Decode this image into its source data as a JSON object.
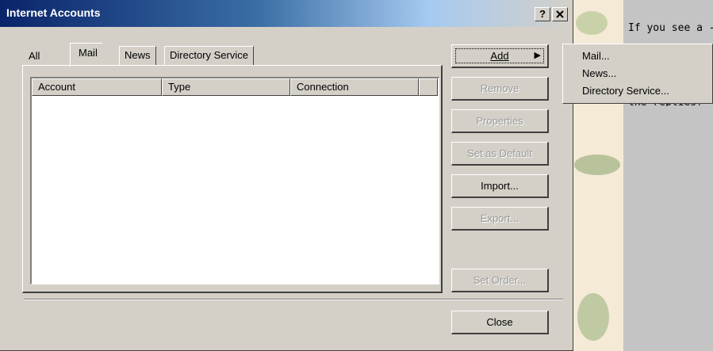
{
  "dialog": {
    "title": "Internet Accounts",
    "help_label": "?",
    "close_icon": "close-icon"
  },
  "tabs": [
    {
      "label": "All",
      "selected": false
    },
    {
      "label": "Mail",
      "selected": true
    },
    {
      "label": "News",
      "selected": false
    },
    {
      "label": "Directory Service",
      "selected": false
    }
  ],
  "list": {
    "columns": [
      "Account",
      "Type",
      "Connection"
    ],
    "rows": []
  },
  "buttons": {
    "add": "Add",
    "remove": "Remove",
    "properties": "Properties",
    "set_default": "Set as Default",
    "import": "Import...",
    "export": "Export...",
    "set_order": "Set Order...",
    "close": "Close"
  },
  "add_menu": {
    "items": [
      "Mail...",
      "News...",
      "Directory Service..."
    ]
  },
  "background": {
    "text_line": "If you see a -",
    "text_line2": "the replies?"
  },
  "colors": {
    "dialog_face": "#d4d0c8",
    "title_active": "#0a246a",
    "disabled_text": "#9a9a9a"
  }
}
